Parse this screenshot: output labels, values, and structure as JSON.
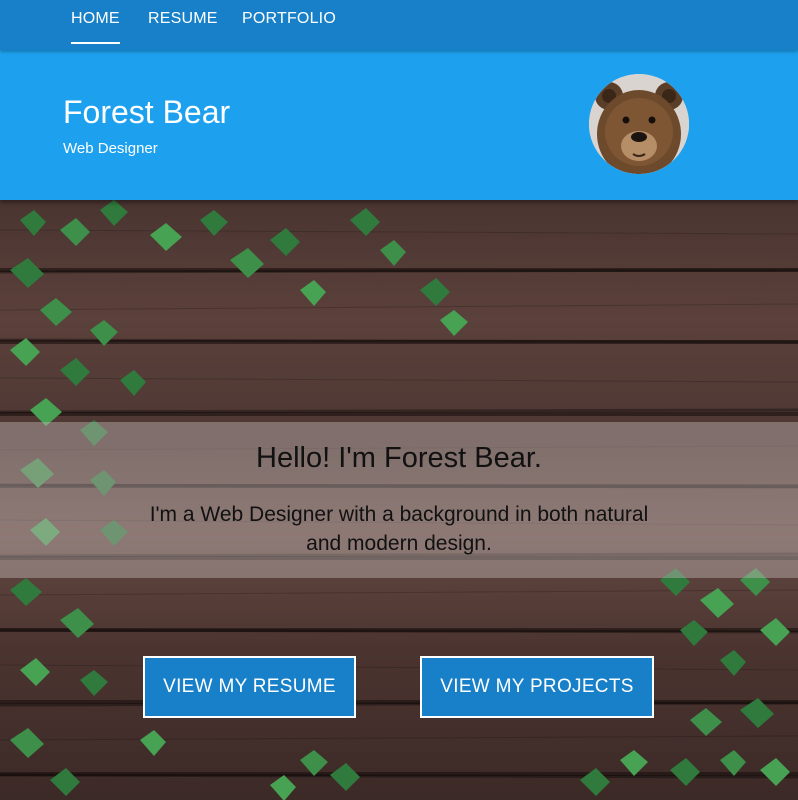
{
  "nav": {
    "items": [
      {
        "label": "HOME"
      },
      {
        "label": "RESUME"
      },
      {
        "label": "PORTFOLIO"
      }
    ]
  },
  "header": {
    "name": "Forest Bear",
    "role": "Web Designer",
    "avatar_icon": "bear-avatar"
  },
  "hero": {
    "title": "Hello! I'm Forest Bear.",
    "text": "I'm a Web Designer with a background in both natural and modern design.",
    "buttons": {
      "resume": "VIEW MY RESUME",
      "projects": "VIEW MY PROJECTS"
    }
  },
  "colors": {
    "nav_bg": "#1780c9",
    "header_bg": "#1da1ef",
    "button_bg": "#1780c9"
  }
}
